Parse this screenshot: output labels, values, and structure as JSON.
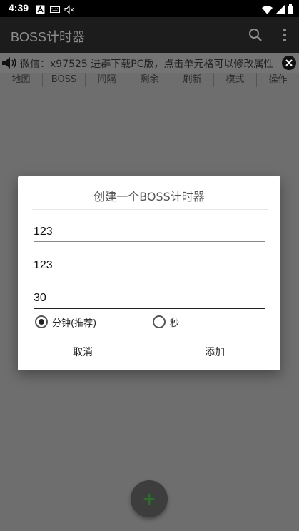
{
  "status_bar": {
    "time": "4:39",
    "icons_left": [
      "a-icon",
      "keyboard-icon",
      "speaker-muted-icon"
    ],
    "icons_right": [
      "wifi-icon",
      "signal-icon",
      "battery-icon"
    ]
  },
  "app_bar": {
    "title": "BOSS计时器",
    "actions": [
      "search-icon",
      "more-vert-icon"
    ]
  },
  "marquee": {
    "text": "微信：x97525 进群下载PC版，点击单元格可以修改属性"
  },
  "columns": [
    "地图",
    "BOSS",
    "间隔",
    "剩余",
    "刷新",
    "模式",
    "操作"
  ],
  "dialog": {
    "title": "创建一个BOSS计时器",
    "fields": [
      {
        "value": "123"
      },
      {
        "value": "123"
      },
      {
        "value": "30"
      }
    ],
    "radios": [
      {
        "label": "分钟(推荐)",
        "checked": true
      },
      {
        "label": "秒",
        "checked": false
      }
    ],
    "cancel_label": "取消",
    "add_label": "添加"
  },
  "fab": {
    "label": "+"
  },
  "colors": {
    "app_bar": "#1c1c1c",
    "overlay": "#6e6e6e",
    "fab_icon": "#2f6a2f"
  }
}
